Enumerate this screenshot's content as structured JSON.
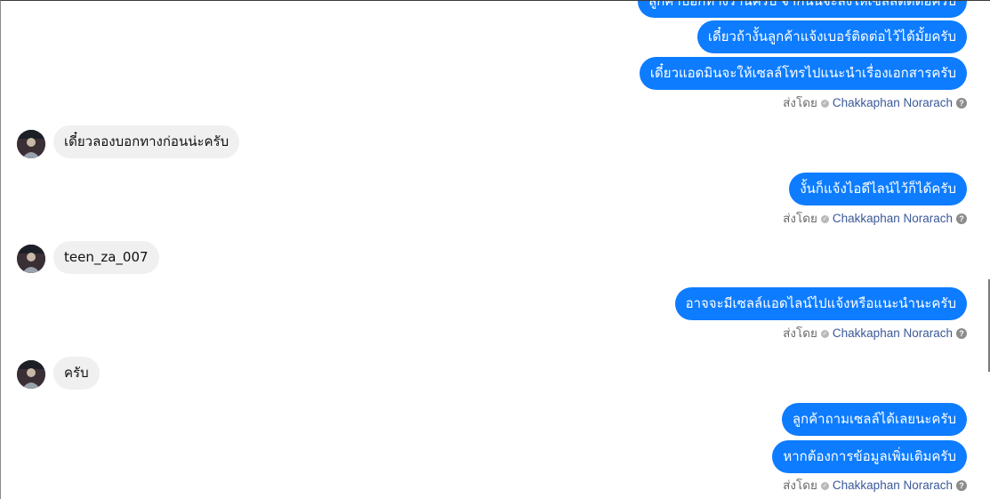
{
  "messages": {
    "out_1": "ลูกค้าบอกทางร้านครับ จากนั้นจะส่งให้เซลล์ติดต่อครับ",
    "out_2": "เดี๋ยวถ้างั้นลูกค้าแจ้งเบอร์ติดต่อไว้ได้มั้ยครับ",
    "out_3": "เดี๋ยวแอดมินจะให้เซลล์โทรไปแนะนำเรื่องเอกสารครับ",
    "in_1": "เดี๋ยวลองบอกทางก่อนน่ะครับ",
    "out_4": "งั้นก็แจ้งไอดีไลน์ไว้ก็ได้ครับ",
    "in_2": "teen_za_007",
    "out_5": "อาจจะมีเซลล์แอดไลน์ไปแจ้งหรือแนะนำนะครับ",
    "in_3": "ครับ",
    "out_6": "ลูกค้าถามเซลล์ได้เลยนะครับ",
    "out_7": "หากต้องการข้อมูลเพิ่มเติมครับ"
  },
  "sent_by": {
    "label": "ส่งโดย",
    "name": "Chakkaphan Norarach",
    "check_icon": "✓",
    "help_icon": "?"
  },
  "colors": {
    "outgoing_bubble": "#0d7cff",
    "incoming_bubble": "#f0f0f0",
    "sender_name": "#3b5998"
  }
}
